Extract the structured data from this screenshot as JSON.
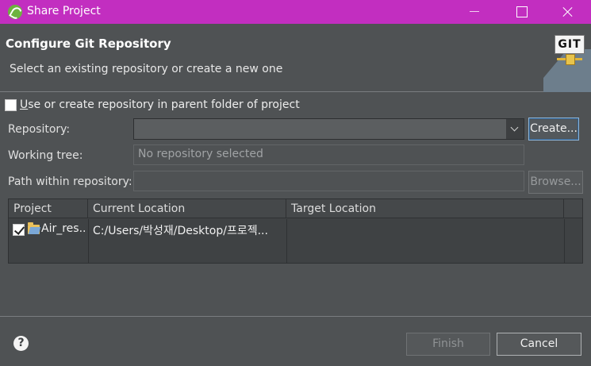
{
  "window": {
    "title": "Share Project",
    "title_bar_color": "#c22ec0"
  },
  "header": {
    "title": "Configure Git Repository",
    "description": "Select an existing repository or create a new one",
    "logo_text": "GIT"
  },
  "form": {
    "parent_repo_checkbox": {
      "prefix": "U",
      "label": "se or create repository in parent folder of project",
      "checked": false
    },
    "repository_label": "Repository:",
    "repository_value": "",
    "create_button": "Create...",
    "working_tree_label": "Working tree:",
    "working_tree_value": "No repository selected",
    "path_label": "Path within repository:",
    "path_value": "",
    "browse_button": "Browse..."
  },
  "table": {
    "headers": [
      "Project",
      "Current Location",
      "Target Location"
    ],
    "rows": [
      {
        "checked": true,
        "project": "Air_res...",
        "current_location": "C:/Users/박성재/Desktop/프로젝...",
        "target_location": ""
      }
    ]
  },
  "footer": {
    "help_icon": "?",
    "finish_button": "Finish",
    "cancel_button": "Cancel"
  },
  "colors": {
    "background": "#4f5254",
    "accent_focus": "#8fb5d8",
    "spring_green": "#6db33f"
  }
}
